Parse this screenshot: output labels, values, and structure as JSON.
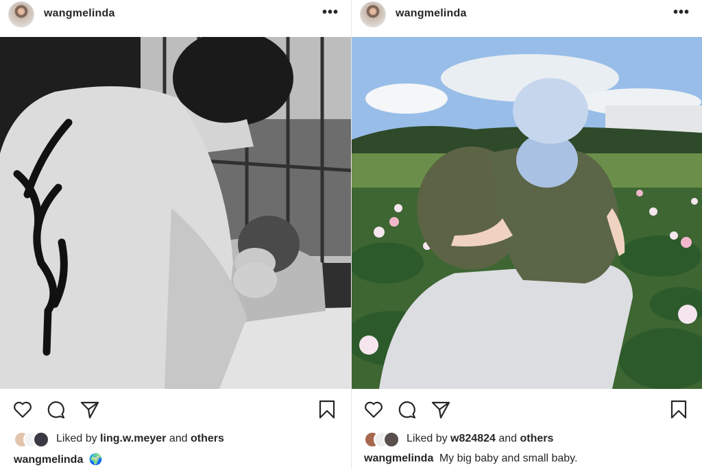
{
  "posts": [
    {
      "username": "wangmelinda",
      "more": "•••",
      "liked_by_prefix": "Liked by",
      "liked_by_user": "ling.w.meyer",
      "liked_by_join": "and",
      "liked_by_others": "others",
      "caption_user": "wangmelinda",
      "caption_text": "🌍",
      "photo_alt": "black and white photo of man with baby"
    },
    {
      "username": "wangmelinda",
      "more": "•••",
      "liked_by_prefix": "Liked by",
      "liked_by_user": "w824824",
      "liked_by_join": "and",
      "liked_by_others": "others",
      "caption_user": "wangmelinda",
      "caption_text": "My big baby and small baby.",
      "photo_alt": "man carrying baby in a lotus field"
    }
  ],
  "colors": {
    "text": "#262626",
    "divider": "#e6e6e6"
  },
  "icons": [
    "heart-icon",
    "comment-icon",
    "share-icon",
    "bookmark-icon",
    "more-icon"
  ]
}
